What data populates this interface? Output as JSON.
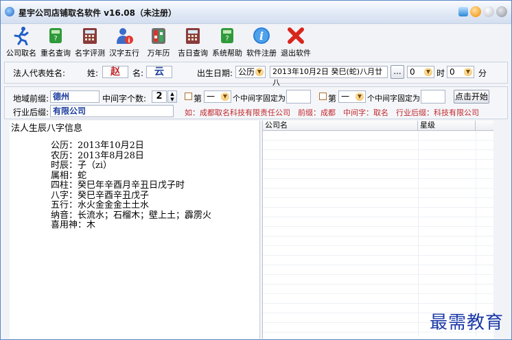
{
  "window": {
    "title": "星宇公司店铺取名软件 v16.08（未注册）"
  },
  "toolbar": [
    {
      "label": "公司取名",
      "icon": "running-man-icon"
    },
    {
      "label": "重名查询",
      "icon": "green-book-icon"
    },
    {
      "label": "名字评测",
      "icon": "calculator-icon"
    },
    {
      "label": "汉字五行",
      "icon": "person-info-icon"
    },
    {
      "label": "万年历",
      "icon": "calendar-toggle-icon"
    },
    {
      "label": "吉日查询",
      "icon": "calendar-grid-icon"
    },
    {
      "label": "系统帮助",
      "icon": "help-book-icon"
    },
    {
      "label": "软件注册",
      "icon": "info-icon"
    },
    {
      "label": "退出软件",
      "icon": "red-x-icon"
    }
  ],
  "form": {
    "legal_rep_label": "法人代表姓名:",
    "surname_label": "姓:",
    "surname_value": "赵",
    "given_label": "名:",
    "given_value": "云",
    "birth_label": "出生日期:",
    "calendar_type": "公历",
    "birth_date": "2013年10月2日  癸巳(蛇)八月廿八",
    "date_button": "...",
    "hour_value": "0",
    "hour_unit": "时",
    "minute_value": "0",
    "minute_unit": "分",
    "region_prefix_label": "地域前缀:",
    "region_prefix_value": "德州",
    "middle_count_label": "中间字个数:",
    "middle_count_value": "2",
    "fix1_prefix": "第",
    "fix1_select": "一",
    "fix1_suffix": "个中间字固定为",
    "fix2_prefix": "第",
    "fix2_select": "一",
    "fix2_suffix": "个中间字固定为",
    "start_button": "点击开始",
    "industry_suffix_label": "行业后缀:",
    "industry_suffix_value": "有限公司",
    "hint": "如：成都取名科技有限责任公司　前缀：成都　中间字：取名　行业后缀：科技有限公司"
  },
  "bazi": {
    "title": "法人生辰八字信息",
    "lines": [
      "公历：2013年10月2日",
      "农历：2013年8月28日",
      "时辰：子（zi）",
      "属相：蛇",
      "四柱：癸巳年辛酉月辛丑日戊子时",
      "八字：癸巳辛酉辛丑戊子",
      "五行：水火金金金土土水",
      "纳音：长流水；石榴木；壁上土；霹雳火",
      "喜用神：木"
    ]
  },
  "results_table": {
    "columns": [
      "公司名",
      "星级"
    ]
  },
  "watermark": "最需教育"
}
